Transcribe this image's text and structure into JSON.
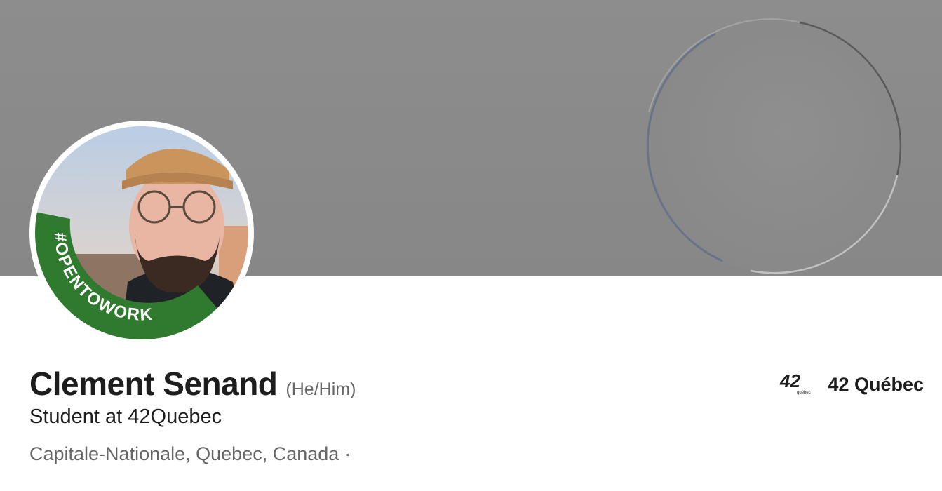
{
  "profile": {
    "name": "Clement Senand",
    "pronouns": "(He/Him)",
    "headline": "Student at 42Quebec",
    "location": "Capitale-Nationale, Quebec, Canada",
    "location_separator": "·",
    "frame_badge": "#OPENTOWORK",
    "frame_color": "#2f7a2f"
  },
  "organization": {
    "name": "42 Québec",
    "logo_text": "42",
    "logo_subtext": "québec",
    "logo_icon": "org-logo-icon"
  },
  "banner": {
    "color": "#8b8b8b"
  },
  "colors": {
    "text_primary": "#1d1d1d",
    "text_secondary": "#666666"
  }
}
